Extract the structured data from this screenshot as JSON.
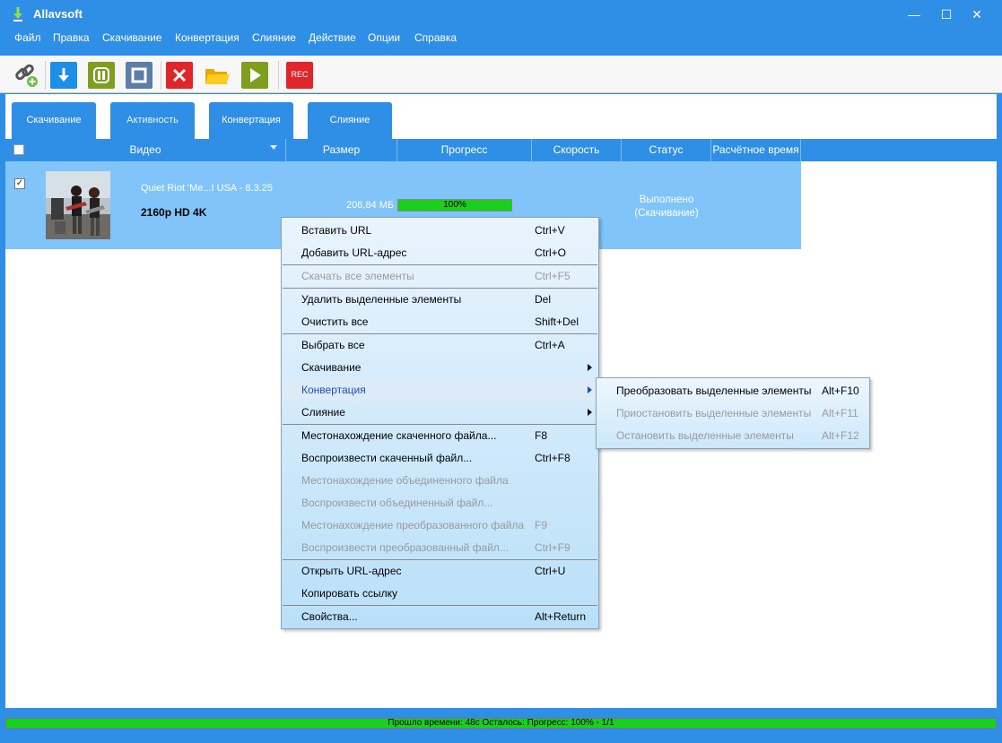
{
  "window": {
    "title": "Allavsoft",
    "minimize": "—",
    "maximize": "☐",
    "close": "✕"
  },
  "menubar": [
    "Файл",
    "Правка",
    "Скачивание",
    "Конвертация",
    "Слияние",
    "Действие",
    "Опции",
    "Справка"
  ],
  "toolbar": {
    "icons": [
      "add-url-icon",
      "download-icon",
      "pause-icon",
      "stop-icon",
      "delete-icon",
      "open-folder-icon",
      "play-icon",
      "record-icon"
    ],
    "rec_label": "REC"
  },
  "tabs": [
    {
      "label": "Скачивание",
      "active": false
    },
    {
      "label": "Активность",
      "active": true
    },
    {
      "label": "Конвертация",
      "active": false
    },
    {
      "label": "Слияние",
      "active": false
    }
  ],
  "table": {
    "columns": [
      "Видео",
      "Размер",
      "Прогресс",
      "Скорость",
      "Статус",
      "Расчётное время"
    ],
    "rows": [
      {
        "checked": true,
        "check_mark": "✓",
        "title": "Quiet Riot 'Me...I USA - 8.3.25",
        "quality": "2160p HD 4K",
        "size": "206,84 МБ",
        "progress": 100,
        "progress_label": "100%",
        "status_line1": "Выполнено",
        "status_line2": "(Скачивание)"
      }
    ]
  },
  "context_menu": {
    "items": [
      {
        "label": "Вставить URL",
        "shortcut": "Ctrl+V",
        "disabled": false
      },
      {
        "label": "Добавить URL-адрес",
        "shortcut": "Ctrl+O",
        "disabled": false
      },
      {
        "label": "Скачать все элементы",
        "shortcut": "Ctrl+F5",
        "disabled": true
      },
      {
        "label": "Удалить выделенные элементы",
        "shortcut": "Del",
        "disabled": false
      },
      {
        "label": "Очистить все",
        "shortcut": "Shift+Del",
        "disabled": false
      },
      {
        "label": "Выбрать все",
        "shortcut": "Ctrl+A",
        "disabled": false
      },
      {
        "label": "Скачивание",
        "shortcut": "",
        "disabled": false,
        "submenu": true
      },
      {
        "label": "Конвертация",
        "shortcut": "",
        "disabled": false,
        "submenu": true,
        "highlighted": true
      },
      {
        "label": "Слияние",
        "shortcut": "",
        "disabled": false,
        "submenu": true
      },
      {
        "label": "Местонахождение скаченного файла...",
        "shortcut": "F8",
        "disabled": false
      },
      {
        "label": "Воспроизвести скаченный файл...",
        "shortcut": "Ctrl+F8",
        "disabled": false
      },
      {
        "label": "Местонахождение объединенного файла",
        "shortcut": "",
        "disabled": true
      },
      {
        "label": "Воспроизвести объединенный файл...",
        "shortcut": "",
        "disabled": true
      },
      {
        "label": "Местонахождение преобразованного файла",
        "shortcut": "F9",
        "disabled": true
      },
      {
        "label": "Воспроизвести преобразованный файл...",
        "shortcut": "Ctrl+F9",
        "disabled": true
      },
      {
        "label": "Открыть URL-адрес",
        "shortcut": "Ctrl+U",
        "disabled": false
      },
      {
        "label": "Копировать ссылку",
        "shortcut": "",
        "disabled": false
      },
      {
        "label": "Свойства...",
        "shortcut": "Alt+Return",
        "disabled": false
      }
    ]
  },
  "submenu": {
    "items": [
      {
        "label": "Преобразовать выделенные элементы",
        "shortcut": "Alt+F10",
        "disabled": false
      },
      {
        "label": "Приостановить выделенные элементы",
        "shortcut": "Alt+F11",
        "disabled": true
      },
      {
        "label": "Остановить выделенные элементы",
        "shortcut": "Alt+F12",
        "disabled": true
      }
    ]
  },
  "statusbar": {
    "text": "Прошло времени: 48с Осталось: Прогресс: 100% - 1/1",
    "progress": 100
  },
  "colors": {
    "accent": "#2f8fe6",
    "row_selected": "#80c4fa",
    "progress_green": "#19d11d"
  }
}
